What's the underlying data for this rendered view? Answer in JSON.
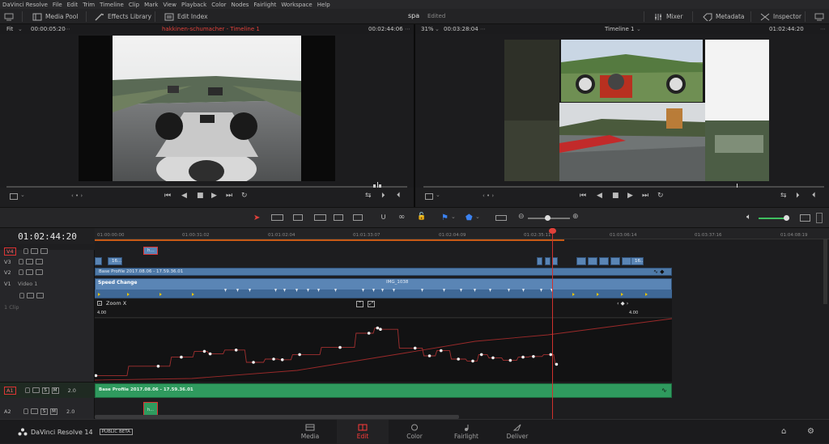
{
  "menu": [
    "DaVinci Resolve",
    "File",
    "Edit",
    "Trim",
    "Timeline",
    "Clip",
    "Mark",
    "View",
    "Playback",
    "Color",
    "Nodes",
    "Fairlight",
    "Workspace",
    "Help"
  ],
  "toolbar": {
    "media_pool": "Media Pool",
    "effects_library": "Effects Library",
    "edit_index": "Edit Index",
    "project_name": "spa",
    "project_status": "Edited",
    "mixer": "Mixer",
    "metadata": "Metadata",
    "inspector": "Inspector"
  },
  "source_viewer": {
    "zoom": "Fit",
    "duration": "00:00:05:20",
    "title": "hakkinen-schumacher - Timeline 1",
    "timecode": "00:02:44:06"
  },
  "timeline_viewer": {
    "zoom": "31%",
    "duration": "00:03:28:04",
    "title": "Timeline 1",
    "timecode": "01:02:44:20"
  },
  "timeline": {
    "current_timecode": "01:02:44:20",
    "ruler": [
      "01:00:00:00",
      "01:00:31:02",
      "01:01:02:04",
      "01:01:33:07",
      "01:02:04:09",
      "01:02:35:11",
      "01:03:06:14",
      "01:03:37:16",
      "01:04:08:19"
    ],
    "tracks": {
      "v4": "V4",
      "v3": "V3",
      "v2": "V2",
      "v1": "V1",
      "v1_name": "Video 1",
      "v1_clips": "1 Clip",
      "a1": "A1",
      "a2": "A2",
      "a1_level": "2.0",
      "a2_level": "2.0",
      "solo": "S",
      "mute": "M"
    },
    "clips": {
      "v4_clip": "h...",
      "v3_clip": "16...",
      "v3_clip_right": "16...",
      "v2_label": "Base Profile 2017.08.06 - 17.59.36.01",
      "speed_change": "Speed Change",
      "clip_name": "IMG_1038",
      "zoom_x": "Zoom X",
      "kf_left_value": "4.00",
      "kf_right_value": "4.00",
      "a1_label": "Base Profile 2017.08.06 - 17.59.36.01",
      "a2_clip": "h..."
    },
    "curve_points": [
      [
        0.002,
        0.905
      ],
      [
        0.11,
        0.76
      ],
      [
        0.15,
        0.62
      ],
      [
        0.19,
        0.53
      ],
      [
        0.2,
        0.57
      ],
      [
        0.245,
        0.51
      ],
      [
        0.275,
        0.7
      ],
      [
        0.31,
        0.65
      ],
      [
        0.325,
        0.66
      ],
      [
        0.355,
        0.58
      ],
      [
        0.425,
        0.47
      ],
      [
        0.475,
        0.25
      ],
      [
        0.49,
        0.17
      ],
      [
        0.495,
        0.19
      ],
      [
        0.555,
        0.48
      ],
      [
        0.58,
        0.6
      ],
      [
        0.6,
        0.52
      ],
      [
        0.63,
        0.65
      ],
      [
        0.655,
        0.68
      ],
      [
        0.67,
        0.58
      ],
      [
        0.69,
        0.63
      ],
      [
        0.72,
        0.67
      ],
      [
        0.742,
        0.62
      ],
      [
        0.76,
        0.61
      ],
      [
        0.79,
        0.58
      ],
      [
        0.8,
        0.73
      ]
    ]
  },
  "pages": [
    "Media",
    "Edit",
    "Color",
    "Fairlight",
    "Deliver"
  ],
  "active_page": "Edit",
  "footer": {
    "app": "DaVinci Resolve 14",
    "badge": "PUBLIC BETA"
  },
  "colors": {
    "accent_red": "#ff3a3a",
    "clip_blue": "#5a85b5",
    "clip_green": "#2f9a5e",
    "ruler_orange": "#c85a16"
  }
}
